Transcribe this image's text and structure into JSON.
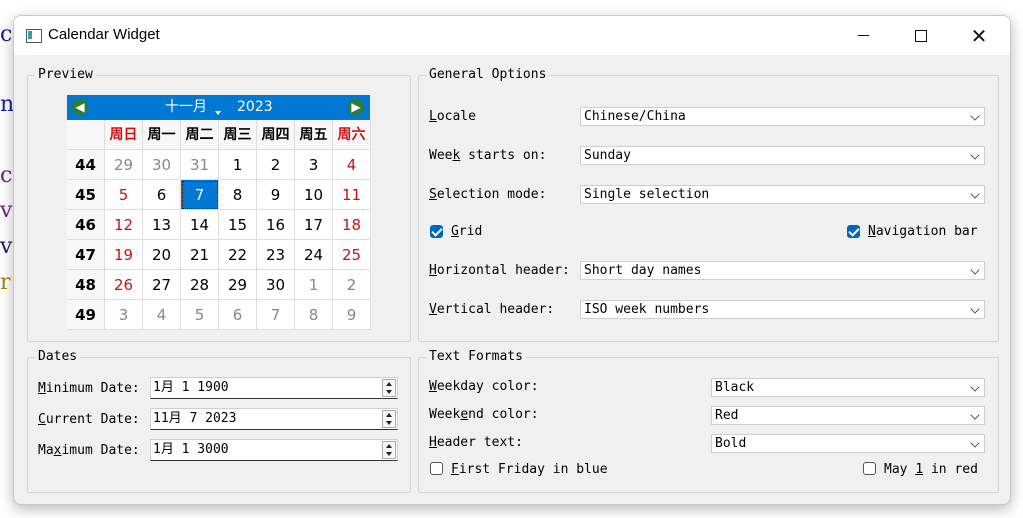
{
  "window": {
    "title": "Calendar Widget",
    "min_label": "",
    "max_label": "",
    "close_label": "✕"
  },
  "colors": {
    "accent": "#0078d4",
    "weekend": "#d01010",
    "nav_arrow": "#2e7d32"
  },
  "preview": {
    "title": "Preview",
    "calendar": {
      "month": "十一月",
      "year": "2023",
      "prev_icon": "◀",
      "next_icon": "▶",
      "weekday_headers": [
        "周日",
        "周一",
        "周二",
        "周三",
        "周四",
        "周五",
        "周六"
      ],
      "weeks": [
        {
          "num": "44",
          "days": [
            "29",
            "30",
            "31",
            "1",
            "2",
            "3",
            "4"
          ],
          "other": [
            true,
            true,
            true,
            false,
            false,
            false,
            false
          ]
        },
        {
          "num": "45",
          "days": [
            "5",
            "6",
            "7",
            "8",
            "9",
            "10",
            "11"
          ],
          "other": [
            false,
            false,
            false,
            false,
            false,
            false,
            false
          ]
        },
        {
          "num": "46",
          "days": [
            "12",
            "13",
            "14",
            "15",
            "16",
            "17",
            "18"
          ],
          "other": [
            false,
            false,
            false,
            false,
            false,
            false,
            false
          ]
        },
        {
          "num": "47",
          "days": [
            "19",
            "20",
            "21",
            "22",
            "23",
            "24",
            "25"
          ],
          "other": [
            false,
            false,
            false,
            false,
            false,
            false,
            false
          ]
        },
        {
          "num": "48",
          "days": [
            "26",
            "27",
            "28",
            "29",
            "30",
            "1",
            "2"
          ],
          "other": [
            false,
            false,
            false,
            false,
            false,
            true,
            true
          ]
        },
        {
          "num": "49",
          "days": [
            "3",
            "4",
            "5",
            "6",
            "7",
            "8",
            "9"
          ],
          "other": [
            true,
            true,
            true,
            true,
            true,
            true,
            true
          ]
        }
      ],
      "selected": "7"
    }
  },
  "general": {
    "title": "General Options",
    "locale_label": "Locale",
    "locale_value": "Chinese/China",
    "week_label": "Week starts on:",
    "week_value": "Sunday",
    "selection_label": "Selection mode:",
    "selection_value": "Single selection",
    "grid_label": "Grid",
    "grid_checked": true,
    "navbar_label": "Navigation bar",
    "navbar_checked": true,
    "hheader_label": "Horizontal header:",
    "hheader_value": "Short day names",
    "vheader_label": "Vertical header:",
    "vheader_value": "ISO week numbers"
  },
  "dates": {
    "title": "Dates",
    "min_label": "Minimum Date:",
    "min_value": "1月 1 1900",
    "cur_label": "Current Date:",
    "cur_value": "11月 7 2023",
    "max_label": "Maximum Date:",
    "max_value": "1月 1 3000"
  },
  "formats": {
    "title": "Text Formats",
    "weekday_label": "Weekday color:",
    "weekday_value": "Black",
    "weekend_label": "Weekend color:",
    "weekend_value": "Red",
    "header_label": "Header text:",
    "header_value": "Bold",
    "friday_label": "First Friday in blue",
    "friday_checked": false,
    "may_label": "May 1 in red",
    "may_checked": false
  }
}
